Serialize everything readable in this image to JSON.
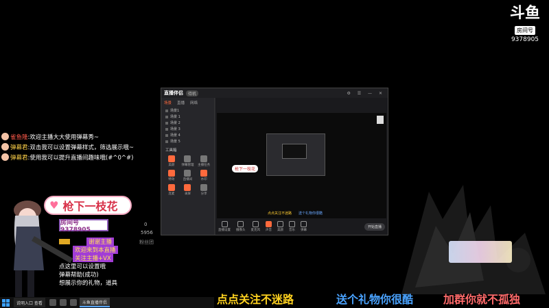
{
  "room": {
    "logo": "斗鱼",
    "tag": "房间号",
    "number": "9378905"
  },
  "chat": [
    {
      "name": "雀鱼隆",
      "msg": ":欢迎主播大大使用弹幕秀~",
      "red": true
    },
    {
      "name": "弹幕君",
      "msg": ":双击我可以设置弹幕样式，筛选展示哦~",
      "red": false
    },
    {
      "name": "弹幕君",
      "msg": ":使用我可以提升直播间趣味哦(#^0^#)",
      "red": false
    }
  ],
  "app": {
    "title": "直播伴侣",
    "pill": "待机",
    "tabs": [
      "场景",
      "直播",
      "网络"
    ],
    "scenes": [
      "场景1",
      "场景 1",
      "场景 2",
      "场景 3",
      "场景 4",
      "场景 5"
    ],
    "tools_heading": "工具箱",
    "tools": [
      "美颜",
      "弹幕管理",
      "主播任务",
      "特效",
      "直播间",
      "水印",
      "连麦",
      "录屏",
      "分享"
    ],
    "preview_banner": "枪下一枝花",
    "preview_scroll_a": "点点关注不迷路",
    "preview_scroll_b": "送个礼物你很酷",
    "controls": [
      "直播设置",
      "摄像头",
      "麦克风",
      "声音",
      "美颜",
      "音乐",
      "弹幕"
    ],
    "start_label": "开始直播"
  },
  "sticker": {
    "text": "枪下一枝花",
    "room_badge": "房间号9378905"
  },
  "stats": {
    "s1": "0",
    "s2": "5956",
    "s3": "粉丝团"
  },
  "chat2": [
    {
      "text": "",
      "hi": "谢谢主播",
      "gold": true
    },
    {
      "text": "",
      "hi": "欢迎来到本直播",
      "gold": false
    },
    {
      "text": "",
      "hi": "关注主播+VX",
      "gold": false
    },
    {
      "text": "点这里可以设置哦",
      "hi": "",
      "gold": false
    },
    {
      "text": "弹幕帮助(成功)",
      "hi": "",
      "gold": false
    },
    {
      "text": "想展示你的礼物，道具",
      "hi": "",
      "gold": false
    }
  ],
  "marquee": {
    "a": "点点关注不迷路",
    "b": "送个礼物你很酷",
    "c": "加群你就不孤独"
  },
  "taskbar": {
    "item1": "说明入口 查看",
    "item2": "斗鱼直播伴侣"
  }
}
